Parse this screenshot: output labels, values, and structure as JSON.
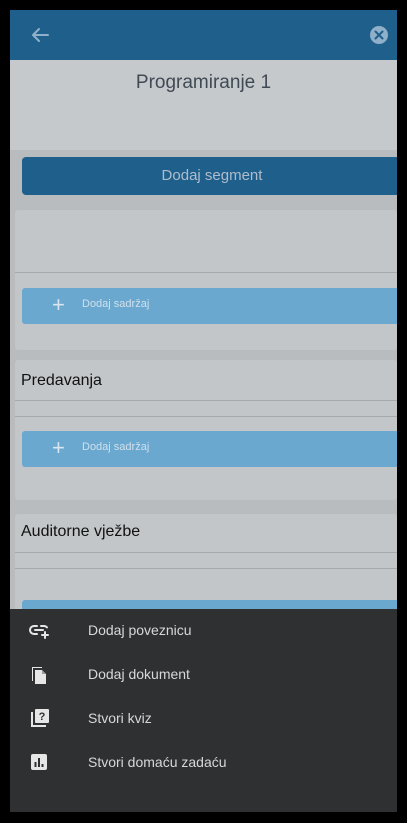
{
  "page_title": "Programiranje 1",
  "add_segment_label": "Dodaj segment",
  "sections": [
    {
      "title": "",
      "add_content_label": "Dodaj sadržaj"
    },
    {
      "title": "Predavanja",
      "add_content_label": "Dodaj sadržaj"
    },
    {
      "title": "Auditorne vježbe",
      "add_content_label": ""
    }
  ],
  "menu": {
    "items": [
      {
        "label": "Dodaj poveznicu",
        "icon": "link-add-icon"
      },
      {
        "label": "Dodaj dokument",
        "icon": "document-icon"
      },
      {
        "label": "Stvori kviz",
        "icon": "quiz-icon"
      },
      {
        "label": "Stvori domaću zadaću",
        "icon": "assignment-chart-icon"
      }
    ]
  },
  "colors": {
    "primary": "#1f5f8c",
    "accent": "#6aa8cf",
    "sheet": "#2e3031",
    "overlay_bg": "#b9bcbf"
  }
}
